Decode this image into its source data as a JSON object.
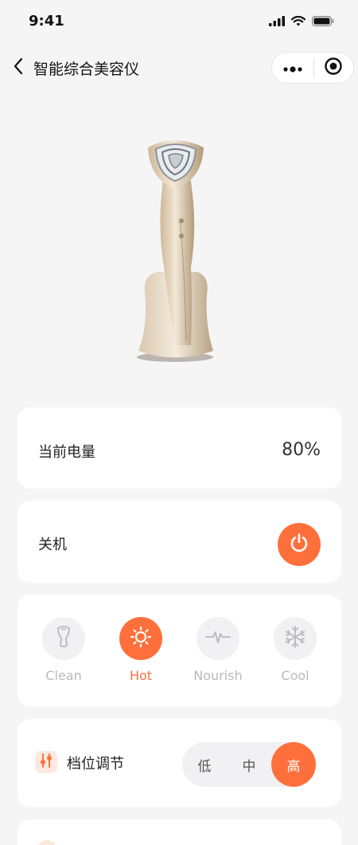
{
  "status_bar": {
    "time": "9:41"
  },
  "nav": {
    "title": "智能综合美容仪"
  },
  "product": {
    "image_alt": "beauty-device"
  },
  "battery": {
    "label": "当前电量",
    "value": "80%"
  },
  "power": {
    "label": "关机"
  },
  "modes": [
    {
      "label": "Clean",
      "icon": "clean-icon",
      "active": false
    },
    {
      "label": "Hot",
      "icon": "sun-icon",
      "active": true
    },
    {
      "label": "Nourish",
      "icon": "pulse-icon",
      "active": false
    },
    {
      "label": "Cool",
      "icon": "snowflake-icon",
      "active": false
    }
  ],
  "level": {
    "label": "档位调节",
    "options": [
      "低",
      "中",
      "高"
    ],
    "selected": "高"
  },
  "colors": {
    "accent": "#ff6f3c",
    "background": "#f5f5f6",
    "muted": "#b9b9be"
  }
}
